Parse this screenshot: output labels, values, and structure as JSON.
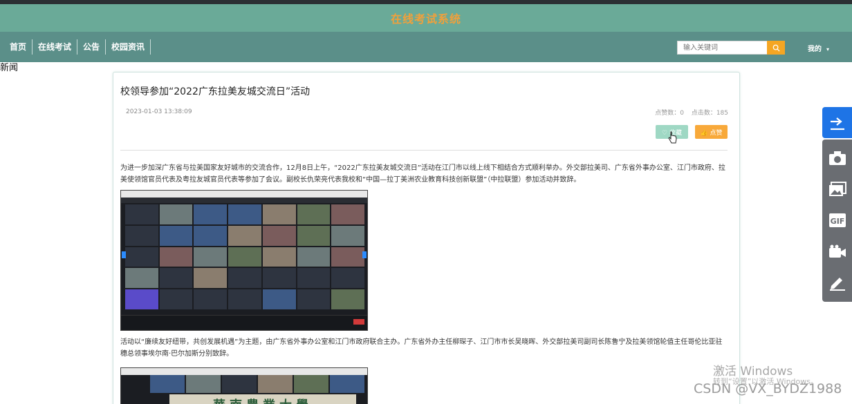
{
  "app": {
    "title": "在线考试系统"
  },
  "nav": {
    "items": [
      "首页",
      "在线考试",
      "公告",
      "校园资讯"
    ],
    "search_placeholder": "输入关键词",
    "user_label": "我的",
    "user_caret": "▾"
  },
  "stray_text": "新闻",
  "article": {
    "title": "校领导参加“2022广东拉美友城交流日”活动",
    "date": "2023-01-03 13:38:09",
    "likes_label": "点赞数：0",
    "clicks_label": "点击数：185",
    "favorite_button": "♡ 收藏",
    "like_button": "👍 点赞",
    "paragraph_1": "为进一步加深广东省与拉美国家友好城市的交流合作，12月8日上午，“2022广东拉美友城交流日”活动在江门市以线上线下相结合方式顺利举办。外交部拉美司、广东省外事办公室、江门市政府、拉美使领馆官员代表及粤拉友城官员代表等参加了会议。副校长仇荣亮代表我校和“中国—拉丁美洲农业教育科技创新联盟”（中拉联盟）参加活动并致辞。",
    "paragraph_2": "活动以“廉续友好纽带，共创发展机遇”为主题，由广东省外事办公室和江门市政府联合主办。广东省外办主任柳琛子、江门市市长吴晓晖、外交部拉美司副司长陈鲁宁及拉美领馆轮值主任哥伦比亚驻穗总领事埃尔南·巴尔加斯分别致辞。",
    "photo2_sign": "華南農業大學"
  },
  "sidebar": {
    "tools": [
      "share-icon",
      "camera-icon",
      "image-icon",
      "gif-icon",
      "video-icon",
      "pen-icon"
    ]
  },
  "overlay": {
    "activate_windows": "激活 Windows",
    "activate_windows_hint": "转到“设置”以激活 Windows。",
    "csdn": "CSDN @VX_BYDZ1988"
  },
  "colors": {
    "banner": "#6aaa98",
    "nav": "#5b8f89",
    "title": "#f2a03a",
    "search_button": "#f5a623",
    "favorite": "#9fd8c4",
    "like": "#f8a93a",
    "share": "#1e74e6"
  }
}
